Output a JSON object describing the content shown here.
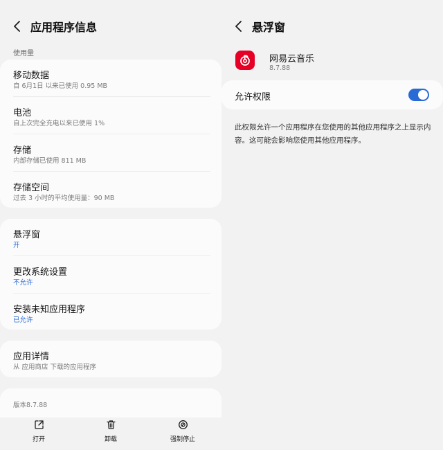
{
  "left": {
    "title": "应用程序信息",
    "usage_label": "使用量",
    "usage_items": [
      {
        "label": "移动数据",
        "sub": "自 6月1日 以来已使用 0.95 MB"
      },
      {
        "label": "电池",
        "sub": "自上次完全充电以来已使用 1%"
      },
      {
        "label": "存储",
        "sub": "内部存储已使用 811 MB"
      },
      {
        "label": "存储空间",
        "sub": "过去 3 小时的平均使用量：90 MB"
      }
    ],
    "permission_items": [
      {
        "label": "悬浮窗",
        "sub": "开"
      },
      {
        "label": "更改系统设置",
        "sub": "不允许"
      },
      {
        "label": "安装未知应用程序",
        "sub": "已允许"
      }
    ],
    "details": {
      "label": "应用详情",
      "sub": "从 应用商店 下载的应用程序"
    },
    "version": "版本8.7.88",
    "bottom_bar": {
      "open": "打开",
      "uninstall": "卸载",
      "force_stop": "强制停止"
    }
  },
  "right": {
    "title": "悬浮窗",
    "app_name": "网易云音乐",
    "app_version": "8.7.88",
    "toggle_label": "允许权限",
    "toggle_on": true,
    "description": "此权限允许一个应用程序在您使用的其他应用程序之上显示内容。这可能会影响您使用其他应用程序。"
  },
  "colors": {
    "accent": "#2a6ad6",
    "app_icon": "#e60026",
    "background": "#f2f2f2",
    "card": "#fbfbfb"
  }
}
